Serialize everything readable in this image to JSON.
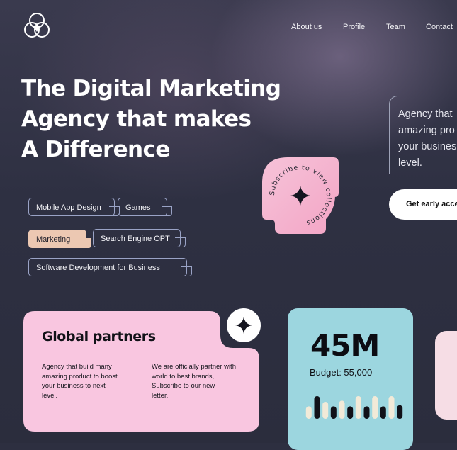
{
  "brand": {
    "logo_icon": "three-circles-logo-icon"
  },
  "nav": {
    "items": [
      "About us",
      "Profile",
      "Team",
      "Contact"
    ]
  },
  "hero": {
    "lines": [
      "The Digital Marketing",
      "Agency that makes",
      "A Difference"
    ]
  },
  "tags": [
    "Mobile App Design",
    "Games",
    "Marketing",
    "Search Engine OPT",
    "Software Development for Business"
  ],
  "selected_tag": "Marketing",
  "badge": {
    "circular_text": "Subscribe to view collections",
    "icon": "four-point-star-icon"
  },
  "aside": {
    "lines": [
      "Agency that",
      "amazing pro",
      "your busines",
      "level."
    ]
  },
  "cta": {
    "label": "Get early acce"
  },
  "partners": {
    "title": "Global partners",
    "left_lines": [
      "Agency that build many",
      "amazing product to boost",
      "your business to next",
      "level."
    ],
    "right_lines": [
      "We are officially partner with",
      "world to best brands,",
      "Subscribe to our new",
      "letter."
    ],
    "icon": "four-point-star-icon"
  },
  "stats": {
    "value": "45M",
    "budget": "Budget: 55,000",
    "bars": [
      0.55,
      1.0,
      0.75,
      0.55,
      0.8,
      0.55,
      1.0,
      0.55,
      1.0,
      0.55,
      1.0,
      0.6
    ]
  },
  "colors": {
    "background": "#2d2f40",
    "pink": "#f9c6e0",
    "blue": "#9cd6df",
    "peach": "#ecc8b2",
    "pale_pink": "#f6dde5"
  }
}
